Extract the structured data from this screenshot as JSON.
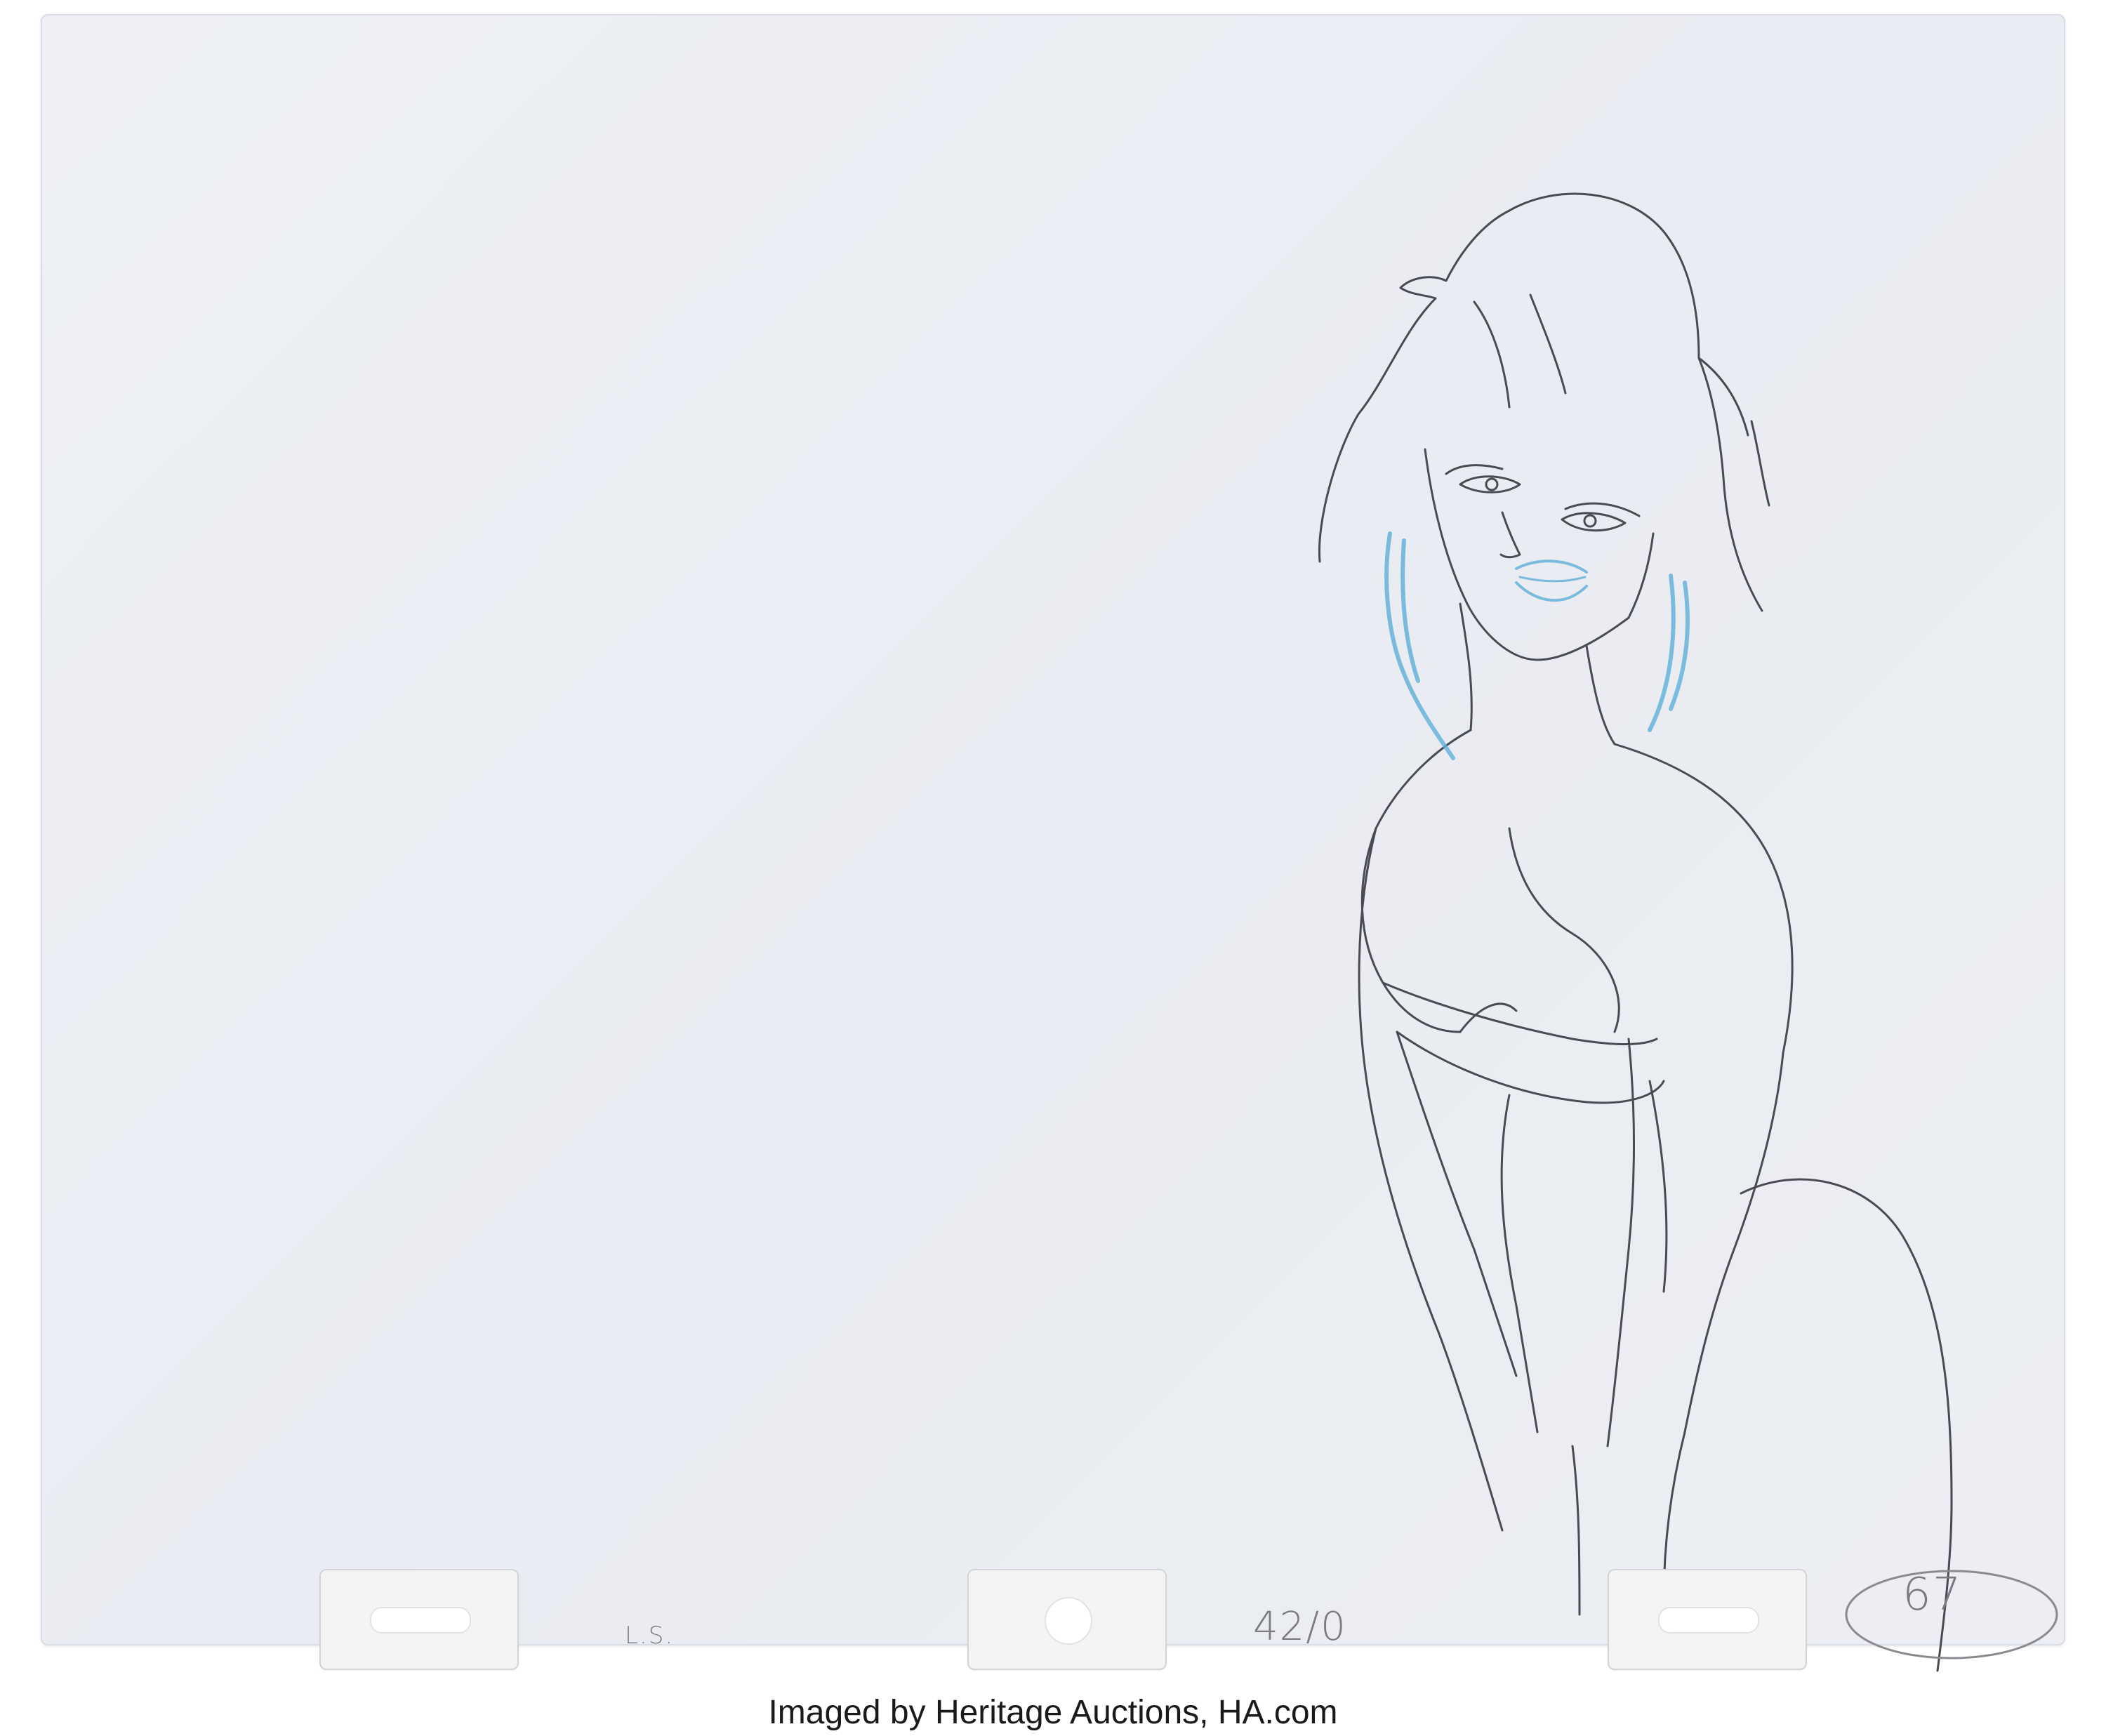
{
  "notes": {
    "layout_mark": "L.S.",
    "scene_code": "42/0",
    "drawing_number": "67"
  },
  "caption": {
    "text": "Imaged by Heritage Auctions, HA.com"
  },
  "colors": {
    "paper": "#eceef3",
    "pencil_line": "#4a4a52",
    "blue_pencil": "#5fb0d9",
    "peg_tab": "#f4f4f4"
  }
}
